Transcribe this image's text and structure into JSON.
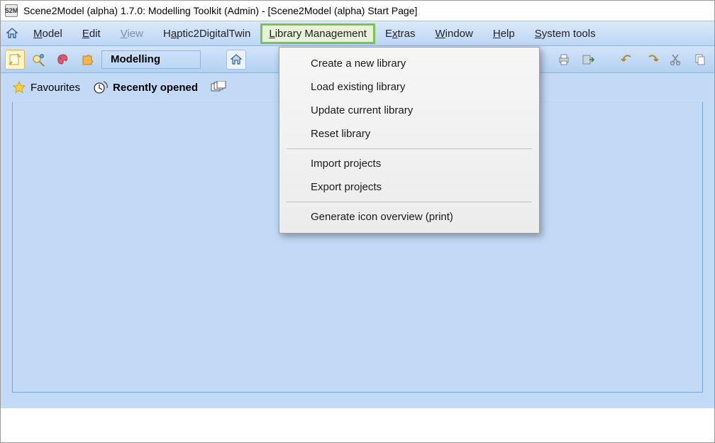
{
  "window": {
    "title": "Scene2Model (alpha) 1.7.0: Modelling Toolkit (Admin) - [Scene2Model (alpha) Start Page]"
  },
  "menubar": {
    "items": [
      {
        "label": "Model",
        "underlineIdx": 0,
        "key": "model",
        "disabled": false
      },
      {
        "label": "Edit",
        "underlineIdx": 0,
        "key": "edit",
        "disabled": false
      },
      {
        "label": "View",
        "underlineIdx": 0,
        "key": "view",
        "disabled": true
      },
      {
        "label": "Haptic2DigitalTwin",
        "underlineIdx": 1,
        "key": "h2dt",
        "disabled": false
      },
      {
        "label": "Library Management",
        "underlineIdx": 0,
        "key": "libmgmt",
        "disabled": false,
        "highlighted": true
      },
      {
        "label": "Extras",
        "underlineIdx": 1,
        "key": "extras",
        "disabled": false
      },
      {
        "label": "Window",
        "underlineIdx": 0,
        "key": "window",
        "disabled": false
      },
      {
        "label": "Help",
        "underlineIdx": 0,
        "key": "help",
        "disabled": false
      },
      {
        "label": "System tools",
        "underlineIdx": 0,
        "key": "systools",
        "disabled": false
      }
    ]
  },
  "toolbar": {
    "modelling_label": "Modelling"
  },
  "secondary": {
    "favourites_label": "Favourites",
    "recent_label": "Recently opened"
  },
  "dropdown": {
    "items": [
      "Create a new library",
      "Load existing library",
      "Update current library",
      "Reset library",
      "---",
      "Import projects",
      "Export projects",
      "---",
      "Generate icon overview (print)"
    ]
  }
}
